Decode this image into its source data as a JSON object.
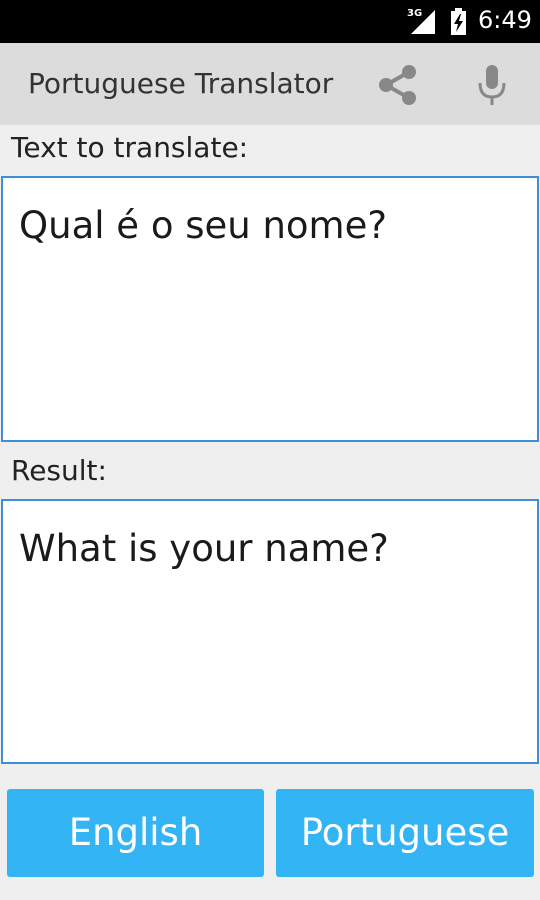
{
  "status_bar": {
    "network": "3G",
    "time": "6:49",
    "icons": [
      "signal-icon",
      "battery-charging-icon"
    ]
  },
  "app_bar": {
    "title": "Portuguese Translator",
    "actions": [
      "share-icon",
      "microphone-icon"
    ]
  },
  "input_section": {
    "label": "Text to translate:",
    "value": "Qual é o seu nome?"
  },
  "result_section": {
    "label": "Result:",
    "value": "What is your name?"
  },
  "language_buttons": {
    "from_label": "English",
    "to_label": "Portuguese"
  },
  "colors": {
    "accent": "#33b5f5",
    "border": "#3f8fd6",
    "app_bar": "#dcdcdc",
    "background": "#efefef"
  }
}
